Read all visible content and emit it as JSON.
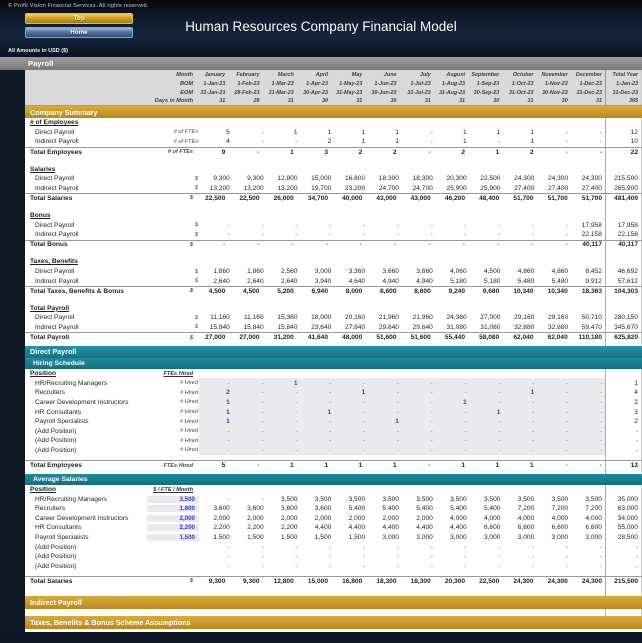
{
  "header": {
    "copyright": "© Profit Vision Financial Services. All rights reserved.",
    "top_button": "Top",
    "home_button": "Home",
    "title": "Human Resources Company Financial Model",
    "amounts_label": "All Amounts in USD ($)"
  },
  "colors": {
    "gold_band": "#C49A2E",
    "teal_band": "#1B8293",
    "gray_band": "#808080",
    "input_blue": "#3A3AC8",
    "input_bg": "#E9E9EE",
    "navy_bg": "#0E1724"
  },
  "payroll_band_label": "Payroll",
  "sheet": {
    "rows": [
      {
        "kind": "cols",
        "label": "",
        "unit": "Month",
        "cells": [
          "January",
          "February",
          "March",
          "April",
          "May",
          "June",
          "July",
          "August",
          "September",
          "October",
          "November",
          "December"
        ],
        "total": "Total Year",
        "name": "header-months"
      },
      {
        "kind": "cols",
        "label": "",
        "unit": "BOM",
        "cells": [
          "1-Jan-23",
          "1-Feb-23",
          "1-Mar-23",
          "1-Apr-23",
          "1-May-23",
          "1-Jun-23",
          "1-Jul-23",
          "1-Aug-23",
          "1-Sep-23",
          "1-Oct-23",
          "1-Nov-23",
          "1-Dec-23"
        ],
        "total": "1-Jan-23",
        "name": "header-bom"
      },
      {
        "kind": "cols",
        "label": "",
        "unit": "EOM",
        "cells": [
          "31-Jan-23",
          "28-Feb-23",
          "31-Mar-23",
          "30-Apr-23",
          "31-May-23",
          "30-Jun-23",
          "31-Jul-23",
          "31-Aug-23",
          "30-Sep-23",
          "31-Oct-23",
          "30-Nov-23",
          "31-Dec-23"
        ],
        "total": "31-Dec-23",
        "name": "header-eom"
      },
      {
        "kind": "cols",
        "last": true,
        "label": "",
        "unit": "Days in Month",
        "cells": [
          "31",
          "28",
          "31",
          "30",
          "31",
          "30",
          "31",
          "31",
          "30",
          "31",
          "30",
          "31"
        ],
        "total": "365",
        "name": "header-days"
      },
      {
        "kind": "band",
        "style": "gold",
        "label": "Company Summary",
        "name": "section-company-summary",
        "collapsible": false
      },
      {
        "kind": "group",
        "label": "# of Employees"
      },
      {
        "kind": "data",
        "label": "Direct Payroll",
        "unit": "# of FTEs",
        "cells": [
          "5",
          "-",
          "1",
          "1",
          "1",
          "1",
          "-",
          "1",
          "1",
          "1",
          "-",
          "-"
        ],
        "total": "12"
      },
      {
        "kind": "data",
        "label": "Indirect Payroll",
        "unit": "# of FTEs",
        "cells": [
          "4",
          "-",
          "-",
          "2",
          "1",
          "1",
          "-",
          "1",
          "-",
          "1",
          "-",
          "-"
        ],
        "total": "10"
      },
      {
        "kind": "total",
        "label": "Total Employees",
        "unit": "# of FTEs",
        "cells": [
          "9",
          "-",
          "1",
          "3",
          "2",
          "2",
          "-",
          "2",
          "1",
          "2",
          "-",
          "-"
        ],
        "total": "22"
      },
      {
        "kind": "spacer",
        "h": 8
      },
      {
        "kind": "group",
        "label": "Salaries"
      },
      {
        "kind": "data",
        "label": "Direct Payroll",
        "unit": "$",
        "cells": [
          "9,300",
          "9,300",
          "12,800",
          "15,000",
          "16,800",
          "18,300",
          "18,300",
          "20,300",
          "22,500",
          "24,300",
          "24,300",
          "24,300"
        ],
        "total": "215,500"
      },
      {
        "kind": "data",
        "label": "Indirect Payroll",
        "unit": "$",
        "cells": [
          "13,200",
          "13,200",
          "13,200",
          "19,700",
          "23,200",
          "24,700",
          "24,700",
          "25,900",
          "25,900",
          "27,400",
          "27,400",
          "27,400"
        ],
        "total": "265,900"
      },
      {
        "kind": "total",
        "label": "Total Salaries",
        "unit": "$",
        "cells": [
          "22,500",
          "22,500",
          "26,000",
          "34,700",
          "40,000",
          "43,000",
          "43,000",
          "46,200",
          "48,400",
          "51,700",
          "51,700",
          "51,700"
        ],
        "total": "481,400"
      },
      {
        "kind": "spacer",
        "h": 8
      },
      {
        "kind": "group",
        "label": "Bonus"
      },
      {
        "kind": "data",
        "label": "Direct Payroll",
        "unit": "$",
        "cells": [
          "-",
          "-",
          "-",
          "-",
          "-",
          "-",
          "-",
          "-",
          "-",
          "-",
          "-",
          "17,958"
        ],
        "total": "17,958"
      },
      {
        "kind": "data",
        "label": "Indirect Payroll",
        "unit": "$",
        "cells": [
          "-",
          "-",
          "-",
          "-",
          "-",
          "-",
          "-",
          "-",
          "-",
          "-",
          "-",
          "22,158"
        ],
        "total": "22,158"
      },
      {
        "kind": "total",
        "label": "Total Bonus",
        "unit": "$",
        "cells": [
          "-",
          "-",
          "-",
          "-",
          "-",
          "-",
          "-",
          "-",
          "-",
          "-",
          "-",
          "40,117"
        ],
        "total": "40,117"
      },
      {
        "kind": "spacer",
        "h": 8
      },
      {
        "kind": "group",
        "label": "Taxes, Benefits"
      },
      {
        "kind": "data",
        "label": "Direct Payroll",
        "unit": "$",
        "cells": [
          "1,860",
          "1,860",
          "2,560",
          "3,000",
          "3,360",
          "3,660",
          "3,660",
          "4,060",
          "4,500",
          "4,860",
          "4,860",
          "8,452"
        ],
        "total": "46,692"
      },
      {
        "kind": "data",
        "label": "Indirect Payroll",
        "unit": "$",
        "cells": [
          "2,640",
          "2,640",
          "2,640",
          "3,940",
          "4,640",
          "4,940",
          "4,940",
          "5,180",
          "5,180",
          "5,480",
          "5,480",
          "9,912"
        ],
        "total": "57,612"
      },
      {
        "kind": "total",
        "label": "Total Taxes, Benefits & Bonus",
        "unit": "$",
        "cells": [
          "4,500",
          "4,500",
          "5,200",
          "6,940",
          "8,000",
          "8,600",
          "8,600",
          "9,240",
          "9,680",
          "10,340",
          "10,340",
          "18,363"
        ],
        "total": "104,303"
      },
      {
        "kind": "spacer",
        "h": 8
      },
      {
        "kind": "group",
        "label": "Total Payroll"
      },
      {
        "kind": "data",
        "label": "Direct Payroll",
        "unit": "$",
        "cells": [
          "11,160",
          "11,160",
          "15,360",
          "18,000",
          "20,160",
          "21,960",
          "21,960",
          "24,360",
          "27,000",
          "29,160",
          "29,160",
          "50,710"
        ],
        "total": "280,150"
      },
      {
        "kind": "data",
        "label": "Indirect Payroll",
        "unit": "$",
        "cells": [
          "15,840",
          "15,840",
          "15,840",
          "23,640",
          "27,840",
          "29,640",
          "29,640",
          "31,080",
          "31,080",
          "32,880",
          "32,880",
          "59,470"
        ],
        "total": "345,670"
      },
      {
        "kind": "total",
        "label": "Total Payroll",
        "unit": "$",
        "cells": [
          "27,000",
          "27,000",
          "31,200",
          "41,640",
          "48,000",
          "51,600",
          "51,600",
          "55,440",
          "58,080",
          "62,040",
          "62,040",
          "110,180"
        ],
        "total": "625,820"
      },
      {
        "kind": "spacer",
        "h": 4
      },
      {
        "kind": "band",
        "style": "teal",
        "label": "Direct Payroll",
        "name": "section-direct-payroll",
        "collapsible": false
      },
      {
        "kind": "band",
        "style": "tealsub",
        "label": "Hiring Schedule",
        "name": "section-hiring-schedule",
        "collapsible": false
      },
      {
        "kind": "poshead",
        "label": "Position",
        "unit": "FTEs Hired"
      },
      {
        "kind": "data",
        "input": "grid",
        "label": "HR/Recruiting Managers",
        "unit": "# Hired",
        "cells": [
          "-",
          "-",
          "1",
          "-",
          "-",
          "-",
          "-",
          "-",
          "-",
          "-",
          "-",
          "-"
        ],
        "total": "1"
      },
      {
        "kind": "data",
        "input": "grid",
        "label": "Recruiters",
        "unit": "# Hired",
        "cells": [
          "2",
          "-",
          "-",
          "-",
          "1",
          "-",
          "-",
          "-",
          "-",
          "1",
          "-",
          "-"
        ],
        "total": "4"
      },
      {
        "kind": "data",
        "input": "grid",
        "label": "Career Development Instructors",
        "unit": "# Hired",
        "cells": [
          "1",
          "-",
          "-",
          "-",
          "-",
          "-",
          "-",
          "1",
          "-",
          "-",
          "-",
          "-"
        ],
        "total": "2"
      },
      {
        "kind": "data",
        "input": "grid",
        "label": "HR Consultants",
        "unit": "# Hired",
        "cells": [
          "1",
          "-",
          "-",
          "1",
          "-",
          "-",
          "-",
          "-",
          "1",
          "-",
          "-",
          "-"
        ],
        "total": "3"
      },
      {
        "kind": "data",
        "input": "grid",
        "label": "Payroll Specialists",
        "unit": "# Hired",
        "cells": [
          "1",
          "-",
          "-",
          "-",
          "-",
          "1",
          "-",
          "-",
          "-",
          "-",
          "-",
          "-"
        ],
        "total": "2"
      },
      {
        "kind": "data",
        "input": "grid",
        "label": "(Add Position)",
        "unit": "# Hired",
        "cells": [
          "-",
          "-",
          "-",
          "-",
          "-",
          "-",
          "-",
          "-",
          "-",
          "-",
          "-",
          "-"
        ],
        "total": "-"
      },
      {
        "kind": "data",
        "input": "grid",
        "label": "(Add Position)",
        "unit": "# Hired",
        "cells": [
          "-",
          "-",
          "-",
          "-",
          "-",
          "-",
          "-",
          "-",
          "-",
          "-",
          "-",
          "-"
        ],
        "total": "-"
      },
      {
        "kind": "data",
        "input": "grid",
        "label": "(Add Position)",
        "unit": "# Hired",
        "cells": [
          "-",
          "-",
          "-",
          "-",
          "-",
          "-",
          "-",
          "-",
          "-",
          "-",
          "-",
          "-"
        ],
        "total": "-"
      },
      {
        "kind": "spacer",
        "h": 5
      },
      {
        "kind": "total",
        "label": "Total Employees",
        "unit": "FTEs Hired",
        "cells": [
          "5",
          "-",
          "1",
          "1",
          "1",
          "1",
          "-",
          "1",
          "1",
          "1",
          "-",
          "-"
        ],
        "total": "12"
      },
      {
        "kind": "spacer",
        "h": 4
      },
      {
        "kind": "band",
        "style": "tealsub",
        "label": "Average Salaries",
        "name": "section-average-salaries",
        "collapsible": false
      },
      {
        "kind": "poshead",
        "label": "Position",
        "unit": "$ / FTE / Month"
      },
      {
        "kind": "data",
        "input": "unit",
        "label": "HR/Recruiting Managers",
        "unit": "3,500",
        "cells": [
          "-",
          "-",
          "3,500",
          "3,500",
          "3,500",
          "3,500",
          "3,500",
          "3,500",
          "3,500",
          "3,500",
          "3,500",
          "3,500"
        ],
        "total": "35,000"
      },
      {
        "kind": "data",
        "input": "unit",
        "label": "Recruiters",
        "unit": "1,800",
        "cells": [
          "3,600",
          "3,600",
          "3,600",
          "3,600",
          "5,400",
          "5,400",
          "5,400",
          "5,400",
          "5,400",
          "7,200",
          "7,200",
          "7,200"
        ],
        "total": "63,000"
      },
      {
        "kind": "data",
        "input": "unit",
        "label": "Career Development Instructors",
        "unit": "2,000",
        "cells": [
          "2,000",
          "2,000",
          "2,000",
          "2,000",
          "2,000",
          "2,000",
          "2,000",
          "4,000",
          "4,000",
          "4,000",
          "4,000",
          "4,000"
        ],
        "total": "34,000"
      },
      {
        "kind": "data",
        "input": "unit",
        "label": "HR Consultants",
        "unit": "2,200",
        "cells": [
          "2,200",
          "2,200",
          "2,200",
          "4,400",
          "4,400",
          "4,400",
          "4,400",
          "4,400",
          "6,600",
          "6,600",
          "6,600",
          "6,600"
        ],
        "total": "55,000"
      },
      {
        "kind": "data",
        "input": "unit",
        "label": "Payroll Specialists",
        "unit": "1,500",
        "cells": [
          "1,500",
          "1,500",
          "1,500",
          "1,500",
          "1,500",
          "3,000",
          "3,000",
          "3,000",
          "3,000",
          "3,000",
          "3,000",
          "3,000"
        ],
        "total": "28,500"
      },
      {
        "kind": "data",
        "input": "unit",
        "label": "(Add Position)",
        "unit": "",
        "cells": [
          "-",
          "-",
          "-",
          "-",
          "-",
          "-",
          "-",
          "-",
          "-",
          "-",
          "-",
          "-"
        ],
        "total": "-"
      },
      {
        "kind": "data",
        "input": "unit",
        "label": "(Add Position)",
        "unit": "",
        "cells": [
          "-",
          "-",
          "-",
          "-",
          "-",
          "-",
          "-",
          "-",
          "-",
          "-",
          "-",
          "-"
        ],
        "total": "-"
      },
      {
        "kind": "data",
        "input": "unit",
        "label": "(Add Position)",
        "unit": "",
        "cells": [
          "-",
          "-",
          "-",
          "-",
          "-",
          "-",
          "-",
          "-",
          "-",
          "-",
          "-",
          "-"
        ],
        "total": "-"
      },
      {
        "kind": "spacer",
        "h": 5
      },
      {
        "kind": "total",
        "label": "Total Salaries",
        "unit": "$",
        "cells": [
          "9,300",
          "9,300",
          "12,800",
          "15,000",
          "16,800",
          "18,300",
          "18,300",
          "20,300",
          "22,500",
          "24,300",
          "24,300",
          "24,300"
        ],
        "total": "215,500"
      },
      {
        "kind": "spacer",
        "h": 10
      },
      {
        "kind": "band",
        "style": "gold",
        "tall": true,
        "label": "Indirect Payroll",
        "name": "section-indirect-payroll",
        "collapsible": true
      },
      {
        "kind": "spacer",
        "h": 7
      },
      {
        "kind": "band",
        "style": "gold",
        "tall": true,
        "label": "Taxes, Benefits & Bonus Scheme Assumptions",
        "name": "section-taxes-benefits-bonus",
        "collapsible": true
      }
    ]
  }
}
